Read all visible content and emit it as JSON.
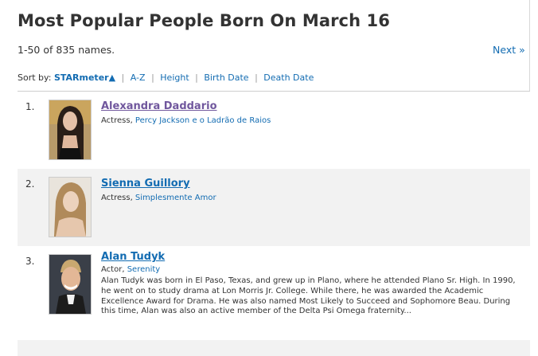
{
  "title": "Most Popular People Born On March 16",
  "count_text": "1-50 of 835 names.",
  "next_label": "Next »",
  "sort": {
    "label": "Sort by:",
    "current": "STARmeter▲",
    "options": [
      "A-Z",
      "Height",
      "Birth Date",
      "Death Date"
    ]
  },
  "people": [
    {
      "rank": "1.",
      "name": "Alexandra Daddario",
      "profession": "Actress",
      "known_for": "Percy Jackson e o Ladrão de Raios",
      "bio": ""
    },
    {
      "rank": "2.",
      "name": "Sienna Guillory",
      "profession": "Actress",
      "known_for": "Simplesmente Amor",
      "bio": ""
    },
    {
      "rank": "3.",
      "name": "Alan Tudyk",
      "profession": "Actor",
      "known_for": "Serenity",
      "bio": "Alan Tudyk was born in El Paso, Texas, and grew up in Plano, where he attended Plano Sr. High. In 1990, he went on to study drama at Lon Morris Jr. College. While there, he was awarded the Academic Excellence Award for Drama. He was also named Most Likely to Succeed and Sophomore Beau. During this time, Alan was also an active member of the Delta Psi Omega fraternity..."
    }
  ],
  "colors": {
    "link": "#136cb2",
    "visited_link": "#70579d",
    "row_alt": "#f2f2f2"
  }
}
